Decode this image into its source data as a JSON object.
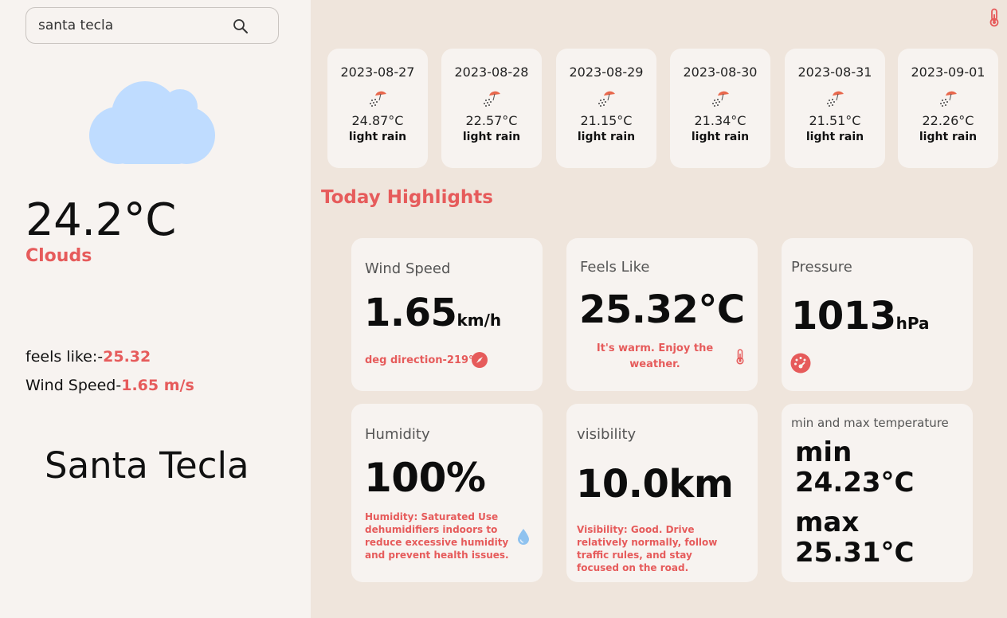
{
  "search": {
    "value": "santa tecla"
  },
  "current": {
    "temperature": "24.2°C",
    "description": "Clouds",
    "feels_like_label": "feels like:-",
    "feels_like_value": "25.32",
    "wind_label": "Wind Speed-",
    "wind_value": "1.65 m/s",
    "city": "Santa Tecla"
  },
  "forecast": [
    {
      "date": "2023-08-27",
      "temp": "24.87°C",
      "desc": "light rain"
    },
    {
      "date": "2023-08-28",
      "temp": "22.57°C",
      "desc": "light rain"
    },
    {
      "date": "2023-08-29",
      "temp": "21.15°C",
      "desc": "light rain"
    },
    {
      "date": "2023-08-30",
      "temp": "21.34°C",
      "desc": "light rain"
    },
    {
      "date": "2023-08-31",
      "temp": "21.51°C",
      "desc": "light rain"
    },
    {
      "date": "2023-09-01",
      "temp": "22.26°C",
      "desc": "light rain"
    }
  ],
  "highlights": {
    "title": "Today Highlights",
    "wind": {
      "title": "Wind Speed",
      "value": "1.65",
      "unit": "km/h",
      "note": "deg direction-219°"
    },
    "feels": {
      "title": "Feels Like",
      "value": "25.32°C",
      "note": "It's warm. Enjoy the weather."
    },
    "pressure": {
      "title": "Pressure",
      "value": "1013",
      "unit": "hPa"
    },
    "humidity": {
      "title": "Humidity",
      "value": "100%",
      "note": "Humidity: Saturated Use dehumidifiers indoors to reduce excessive humidity and prevent health issues."
    },
    "visibility": {
      "title": "visibility",
      "value": "10.0km",
      "note": "Visibility: Good. Drive relatively normally, follow traffic rules, and stay focused on the road."
    },
    "minmax": {
      "title": "min and max temperature",
      "min_label": "min",
      "min_value": "24.23°C",
      "max_label": "max",
      "max_value": "25.31°C"
    }
  },
  "icons": {
    "cloud": "cloud-icon",
    "rain": "rain-icon",
    "search": "search-icon",
    "thermometer": "thermometer-icon",
    "compass": "compass-icon",
    "gauge": "gauge-icon",
    "droplet": "droplet-icon"
  },
  "colors": {
    "accent": "#e65b5b",
    "cloud": "#bfdcff",
    "panel": "#f7f3f0",
    "background": "#efe5dc"
  }
}
